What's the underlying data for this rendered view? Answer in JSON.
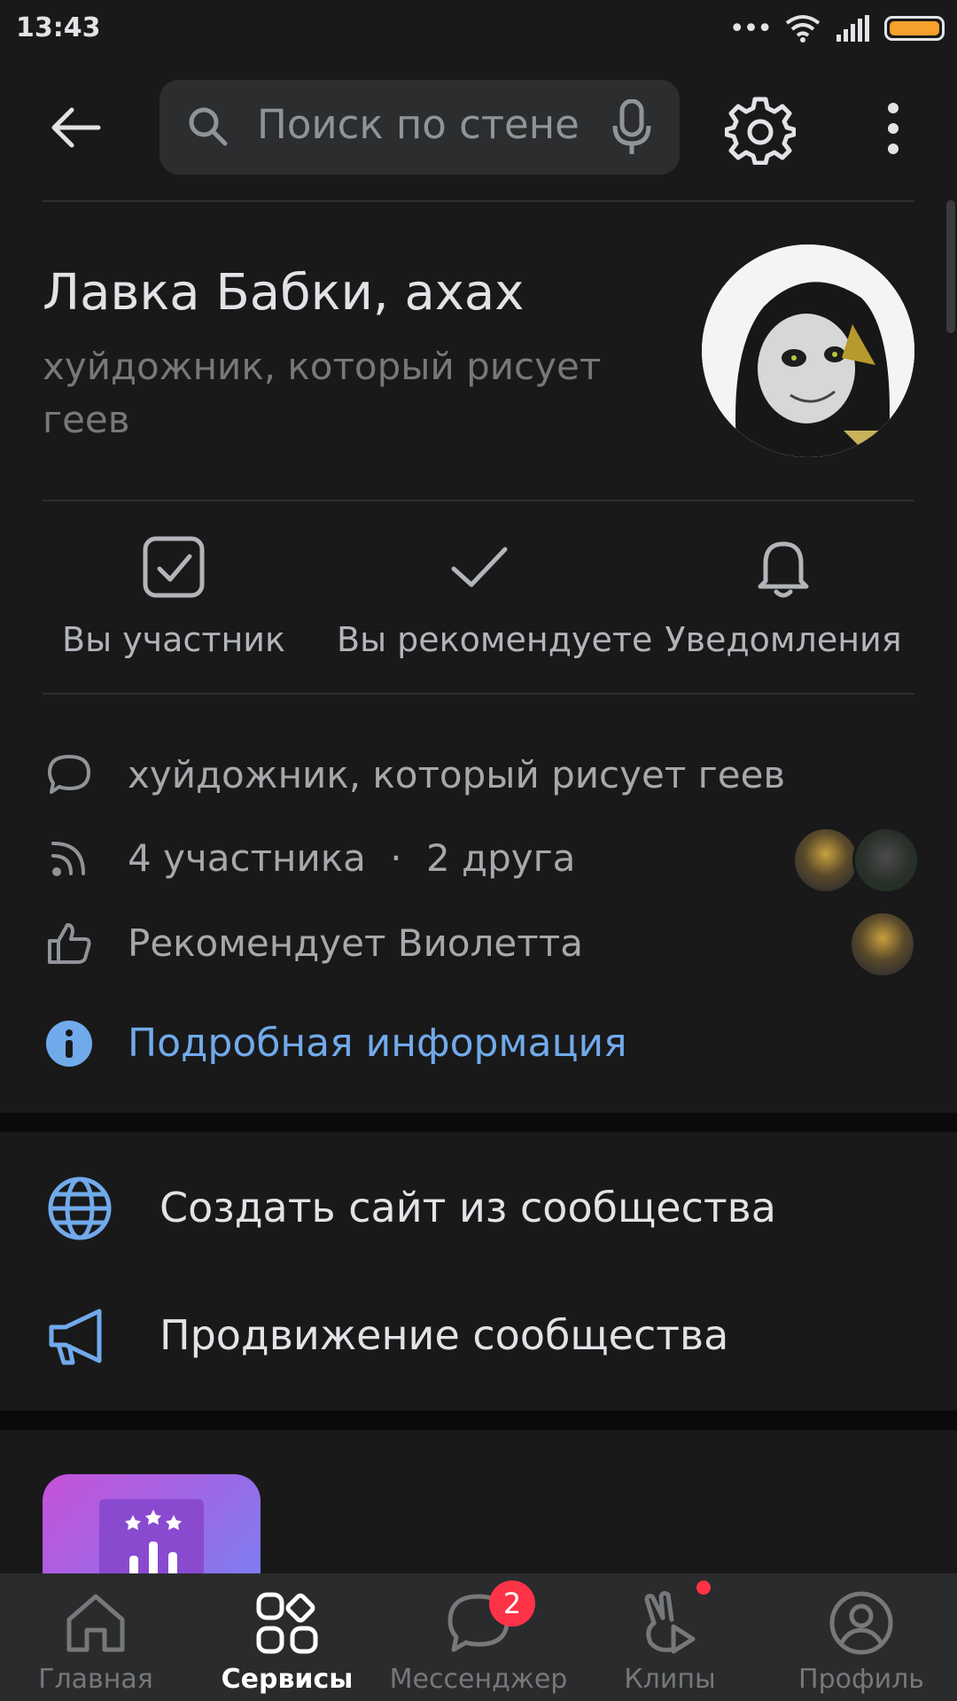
{
  "status_bar": {
    "time": "13:43",
    "battery_color": "#f6a02d"
  },
  "topbar": {
    "search_placeholder": "Поиск по стене"
  },
  "group": {
    "name": "Лавка Бабки, ахах",
    "status": "хуйдожник, который рисует геев"
  },
  "actions": [
    {
      "label": "Вы участник",
      "icon": "checkbox-icon"
    },
    {
      "label": "Вы рекомендуете",
      "icon": "check-icon"
    },
    {
      "label": "Уведомления",
      "icon": "bell-icon"
    }
  ],
  "info": {
    "description": "хуйдожник, который рисует геев",
    "members": "4 участника",
    "separator": "·",
    "friends": "2 друга",
    "recommended_by": "Рекомендует Виолетта",
    "details_link": "Подробная информация"
  },
  "menu": {
    "create_site": "Создать сайт из сообщества",
    "promotion": "Продвижение сообщества"
  },
  "tabs": [
    {
      "label": "Главная",
      "icon": "home-icon"
    },
    {
      "label": "Сервисы",
      "icon": "services-icon",
      "active": true
    },
    {
      "label": "Мессенджер",
      "icon": "messenger-icon",
      "badge": "2"
    },
    {
      "label": "Клипы",
      "icon": "clips-icon",
      "dot": true
    },
    {
      "label": "Профиль",
      "icon": "profile-icon"
    }
  ],
  "colors": {
    "accent": "#71aaeb",
    "badge": "#ff3347",
    "background": "#19191a"
  }
}
